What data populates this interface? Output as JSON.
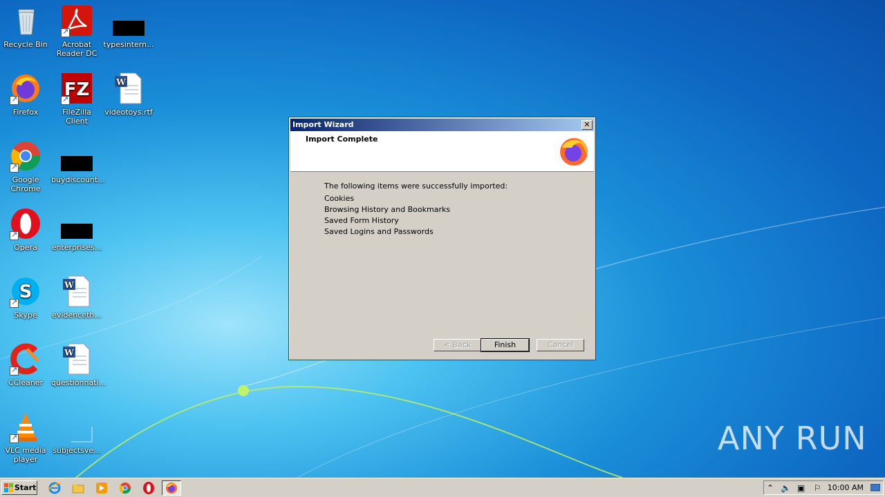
{
  "desktop": {
    "icons": [
      {
        "label": "Recycle Bin"
      },
      {
        "label": "Acrobat Reader DC"
      },
      {
        "label": "typesintern..."
      },
      {
        "label": "Firefox"
      },
      {
        "label": "FileZilla Client"
      },
      {
        "label": "videotoys.rtf"
      },
      {
        "label": "Google Chrome"
      },
      {
        "label": "buydiscount..."
      },
      {
        "label": "Opera"
      },
      {
        "label": "enterprises..."
      },
      {
        "label": "Skype"
      },
      {
        "label": "evidenceth..."
      },
      {
        "label": "CCleaner"
      },
      {
        "label": "questionnati..."
      },
      {
        "label": "VLC media player"
      },
      {
        "label": "subjectsve..."
      }
    ]
  },
  "dialog": {
    "title": "Import Wizard",
    "close_label": "✕",
    "header_title": "Import Complete",
    "intro": "The following items were successfully imported:",
    "items": [
      "Cookies",
      "Browsing History and Bookmarks",
      "Saved Form History",
      "Saved Logins and Passwords"
    ],
    "buttons": {
      "back": "< Back",
      "finish": "Finish",
      "cancel": "Cancel"
    }
  },
  "taskbar": {
    "start_label": "Start",
    "clock": "10:00 AM",
    "pinned": [
      "internet-explorer-icon",
      "explorer-icon",
      "media-player-icon",
      "chrome-icon",
      "opera-icon",
      "firefox-icon"
    ]
  },
  "watermark": "ANY RUN"
}
